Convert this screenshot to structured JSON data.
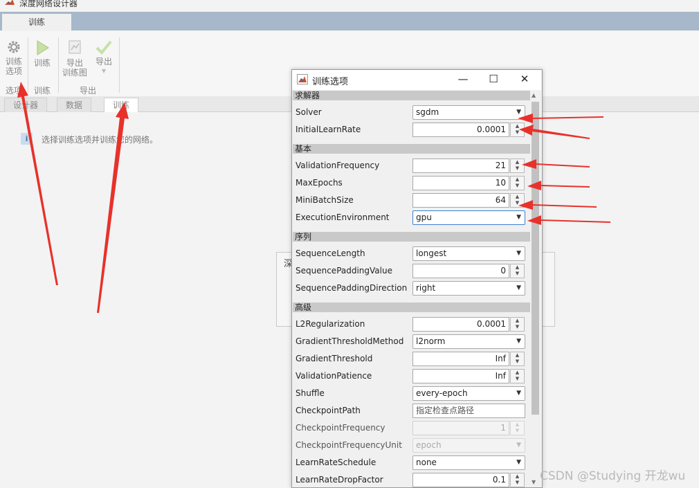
{
  "app": {
    "title": "深度网络设计器",
    "ribbon_tab": "训练"
  },
  "toolbar": {
    "train_options_label_1": "训练",
    "train_options_label_2": "选项",
    "train_label": "训练",
    "export_plot_label_1": "导出",
    "export_plot_label_2": "训练图",
    "export_label": "导出",
    "group_options": "选项",
    "group_train": "训练",
    "group_export": "导出"
  },
  "doc_tabs": [
    "设计器",
    "数据",
    "训练"
  ],
  "workspace": {
    "info_text": "选择训练选项并训练您的网络。",
    "info_icon_glyph": "i",
    "background_dialog_title": "深"
  },
  "dialog": {
    "title": "训练选项",
    "minimize": "—",
    "maximize": "☐",
    "close": "✕",
    "sections": {
      "solver": "求解器",
      "basic": "基本",
      "sequence": "序列",
      "advanced": "高级"
    },
    "fields": {
      "solver": {
        "label": "Solver",
        "value": "sgdm"
      },
      "initial_learn_rate": {
        "label": "InitialLearnRate",
        "value": "0.0001"
      },
      "validation_frequency": {
        "label": "ValidationFrequency",
        "value": "21"
      },
      "max_epochs": {
        "label": "MaxEpochs",
        "value": "10"
      },
      "mini_batch_size": {
        "label": "MiniBatchSize",
        "value": "64"
      },
      "execution_environment": {
        "label": "ExecutionEnvironment",
        "value": "gpu"
      },
      "sequence_length": {
        "label": "SequenceLength",
        "value": "longest"
      },
      "sequence_padding_value": {
        "label": "SequencePaddingValue",
        "value": "0"
      },
      "sequence_padding_direction": {
        "label": "SequencePaddingDirection",
        "value": "right"
      },
      "l2_regularization": {
        "label": "L2Regularization",
        "value": "0.0001"
      },
      "gradient_threshold_method": {
        "label": "GradientThresholdMethod",
        "value": "l2norm"
      },
      "gradient_threshold": {
        "label": "GradientThreshold",
        "value": "Inf"
      },
      "validation_patience": {
        "label": "ValidationPatience",
        "value": "Inf"
      },
      "shuffle": {
        "label": "Shuffle",
        "value": "every-epoch"
      },
      "checkpoint_path": {
        "label": "CheckpointPath",
        "placeholder": "指定检查点路径"
      },
      "checkpoint_frequency": {
        "label": "CheckpointFrequency",
        "value": "1"
      },
      "checkpoint_frequency_unit": {
        "label": "CheckpointFrequencyUnit",
        "value": "epoch"
      },
      "learn_rate_schedule": {
        "label": "LearnRateSchedule",
        "value": "none"
      },
      "learn_rate_drop_factor": {
        "label": "LearnRateDropFactor",
        "value": "0.1"
      }
    }
  },
  "watermark": "CSDN @Studying 开龙wu",
  "colors": {
    "annotation_arrow": "#e8312b",
    "ribbon_strip": "#a6b8c9",
    "section_header": "#c9c9c9"
  }
}
